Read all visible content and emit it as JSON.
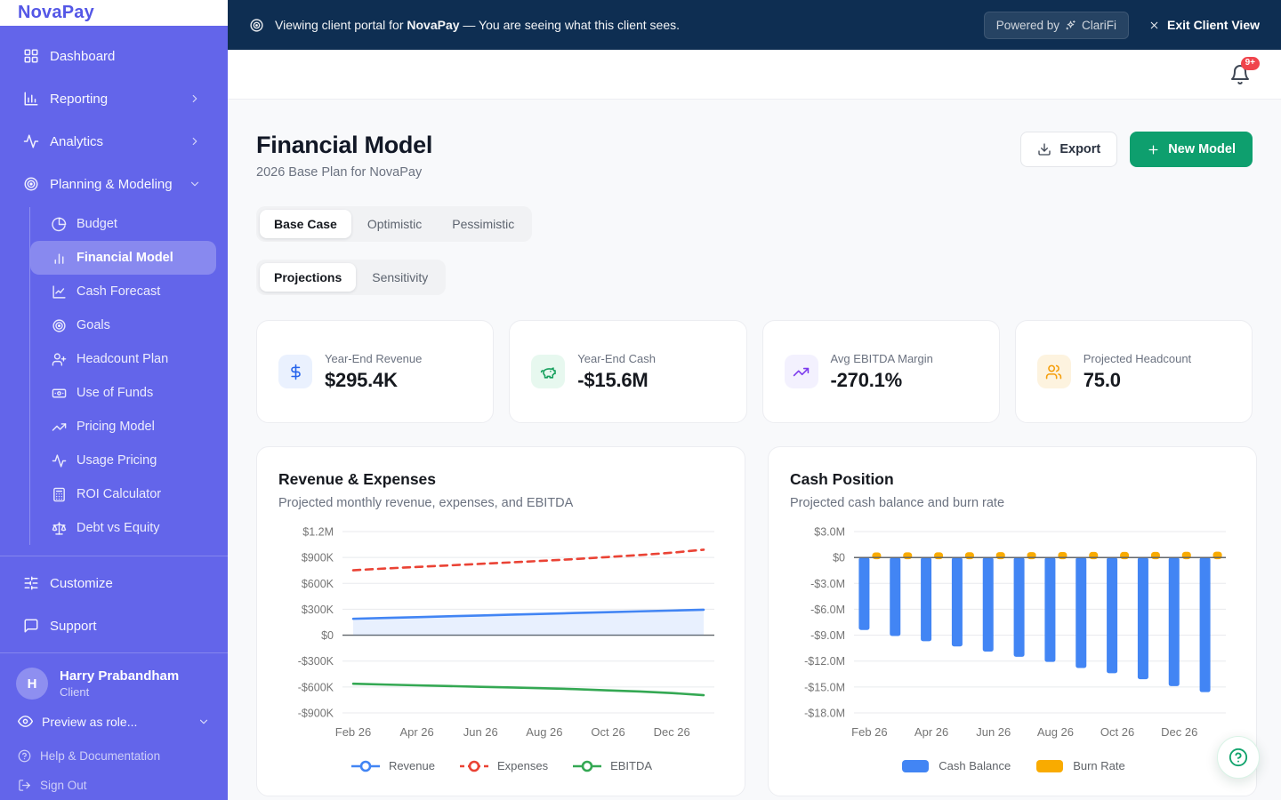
{
  "banner": {
    "message_prefix": "Viewing client portal for",
    "client_name": "NovaPay",
    "message_suffix": "— You are seeing what this client sees.",
    "powered_prefix": "Powered by",
    "powered_brand": "ClariFi",
    "exit_label": "Exit Client View"
  },
  "topbar": {
    "notification_badge": "9+"
  },
  "sidebar": {
    "logo": "NovaPay",
    "nav": [
      {
        "label": "Dashboard",
        "icon": "grid",
        "chevron": ""
      },
      {
        "label": "Reporting",
        "icon": "bar-axis",
        "chevron": "right"
      },
      {
        "label": "Analytics",
        "icon": "activity",
        "chevron": "right"
      },
      {
        "label": "Planning & Modeling",
        "icon": "target",
        "chevron": "down"
      }
    ],
    "subnav": [
      {
        "label": "Budget",
        "icon": "pie",
        "active": false
      },
      {
        "label": "Financial Model",
        "icon": "bars",
        "active": true
      },
      {
        "label": "Cash Forecast",
        "icon": "line-chart",
        "active": false
      },
      {
        "label": "Goals",
        "icon": "target",
        "active": false
      },
      {
        "label": "Headcount Plan",
        "icon": "user-plus",
        "active": false
      },
      {
        "label": "Use of Funds",
        "icon": "banknote",
        "active": false
      },
      {
        "label": "Pricing Model",
        "icon": "trending-up",
        "active": false
      },
      {
        "label": "Usage Pricing",
        "icon": "activity",
        "active": false
      },
      {
        "label": "ROI Calculator",
        "icon": "calculator",
        "active": false
      },
      {
        "label": "Debt vs Equity",
        "icon": "scale",
        "active": false
      }
    ],
    "footer_nav": [
      {
        "label": "Customize",
        "icon": "sliders"
      },
      {
        "label": "Support",
        "icon": "message"
      }
    ],
    "user": {
      "initial": "H",
      "name": "Harry Prabandham",
      "role": "Client"
    },
    "preview_label": "Preview as role...",
    "links": [
      {
        "label": "Help & Documentation",
        "icon": "help"
      },
      {
        "label": "Sign Out",
        "icon": "logout"
      }
    ]
  },
  "page": {
    "title": "Financial Model",
    "subtitle": "2026 Base Plan for NovaPay",
    "export_label": "Export",
    "new_model_label": "New Model",
    "scenario_tabs": [
      "Base Case",
      "Optimistic",
      "Pessimistic"
    ],
    "active_scenario": "Base Case",
    "view_tabs": [
      "Projections",
      "Sensitivity"
    ],
    "active_view": "Projections"
  },
  "metrics": [
    {
      "label": "Year-End Revenue",
      "value": "$295.4K",
      "icon": "dollar",
      "color": "#2563EB",
      "bg": "#EAF1FE"
    },
    {
      "label": "Year-End Cash",
      "value": "-$15.6M",
      "icon": "piggy",
      "color": "#17A05E",
      "bg": "#E7F8EF"
    },
    {
      "label": "Avg EBITDA Margin",
      "value": "-270.1%",
      "icon": "trending-up",
      "color": "#7C3AED",
      "bg": "#F3F1FE"
    },
    {
      "label": "Projected Headcount",
      "value": "75.0",
      "icon": "users",
      "color": "#F59E0B",
      "bg": "#FDF3DF"
    }
  ],
  "chart_data": [
    {
      "type": "line",
      "title": "Revenue & Expenses",
      "subtitle": "Projected monthly revenue, expenses, and EBITDA",
      "x": [
        "Feb 26",
        "Mar 26",
        "Apr 26",
        "May 26",
        "Jun 26",
        "Jul 26",
        "Aug 26",
        "Sep 26",
        "Oct 26",
        "Nov 26",
        "Dec 26",
        "Jan 27"
      ],
      "x_tick_indices": [
        0,
        2,
        4,
        6,
        8,
        10
      ],
      "unit": "K USD",
      "ylim": [
        -900,
        1200
      ],
      "y_ticks": [
        {
          "v": 1200,
          "label": "$1.2M"
        },
        {
          "v": 900,
          "label": "$900K"
        },
        {
          "v": 600,
          "label": "$600K"
        },
        {
          "v": 300,
          "label": "$300K"
        },
        {
          "v": 0,
          "label": "$0"
        },
        {
          "v": -300,
          "label": "-$300K"
        },
        {
          "v": -600,
          "label": "-$600K"
        },
        {
          "v": -900,
          "label": "-$900K"
        }
      ],
      "series": [
        {
          "name": "Revenue",
          "color": "#4285F4",
          "style": "solid",
          "area": true,
          "values": [
            190,
            200,
            209,
            219,
            228,
            238,
            247,
            257,
            266,
            276,
            285,
            295
          ]
        },
        {
          "name": "Expenses",
          "color": "#EA4335",
          "style": "dashed",
          "area": false,
          "values": [
            752,
            772,
            790,
            808,
            826,
            844,
            862,
            882,
            905,
            928,
            955,
            990
          ]
        },
        {
          "name": "EBITDA",
          "color": "#34A853",
          "style": "solid",
          "area": false,
          "values": [
            -562,
            -572,
            -581,
            -589,
            -598,
            -606,
            -615,
            -625,
            -639,
            -652,
            -670,
            -695
          ]
        }
      ],
      "legend_position": "bottom",
      "grid": true
    },
    {
      "type": "bar",
      "title": "Cash Position",
      "subtitle": "Projected cash balance and burn rate",
      "x": [
        "Feb 26",
        "Mar 26",
        "Apr 26",
        "May 26",
        "Jun 26",
        "Jul 26",
        "Aug 26",
        "Sep 26",
        "Oct 26",
        "Nov 26",
        "Dec 26",
        "Jan 27"
      ],
      "x_tick_indices": [
        0,
        2,
        4,
        6,
        8,
        10
      ],
      "unit": "M USD",
      "ylim": [
        -18,
        3
      ],
      "y_ticks": [
        {
          "v": 3,
          "label": "$3.0M"
        },
        {
          "v": 0,
          "label": "$0"
        },
        {
          "v": -3,
          "label": "-$3.0M"
        },
        {
          "v": -6,
          "label": "-$6.0M"
        },
        {
          "v": -9,
          "label": "-$9.0M"
        },
        {
          "v": -12,
          "label": "-$12.0M"
        },
        {
          "v": -15,
          "label": "-$15.0M"
        },
        {
          "v": -18,
          "label": "-$18.0M"
        }
      ],
      "series": [
        {
          "name": "Cash Balance",
          "color": "#4285F4",
          "values": [
            -8.4,
            -9.1,
            -9.7,
            -10.3,
            -10.9,
            -11.5,
            -12.1,
            -12.8,
            -13.4,
            -14.1,
            -14.9,
            -15.6
          ]
        },
        {
          "name": "Burn Rate",
          "color": "#F9AB00",
          "values": [
            0.58,
            0.59,
            0.6,
            0.61,
            0.62,
            0.62,
            0.63,
            0.64,
            0.64,
            0.65,
            0.66,
            0.67
          ]
        }
      ],
      "legend_position": "bottom",
      "grid": true
    }
  ]
}
